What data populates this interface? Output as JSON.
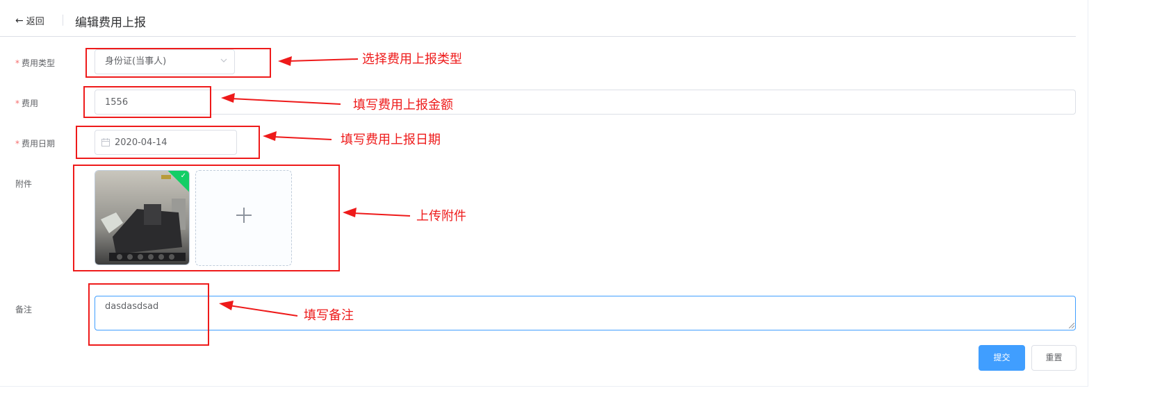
{
  "header": {
    "back_label": "返回",
    "title": "编辑费用上报"
  },
  "form": {
    "type_label": "费用类型",
    "type_value": "身份证(当事人)",
    "amount_label": "费用",
    "amount_value": "1556",
    "date_label": "费用日期",
    "date_value": "2020-04-14",
    "attachment_label": "附件",
    "remark_label": "备注",
    "remark_value": "dasdasdsad"
  },
  "buttons": {
    "submit": "提交",
    "reset": "重置"
  },
  "annotations": {
    "type": "选择费用上报类型",
    "amount": "填写费用上报金额",
    "date": "填写费用上报日期",
    "attachment": "上传附件",
    "remark": "填写备注"
  },
  "colors": {
    "primary": "#409eff",
    "required": "#f56c6c",
    "annotation": "#ee1a1a",
    "upload_success": "#13ce66"
  },
  "icons": [
    "back-arrow-icon",
    "chevron-down-icon",
    "calendar-icon",
    "check-icon",
    "plus-icon"
  ]
}
